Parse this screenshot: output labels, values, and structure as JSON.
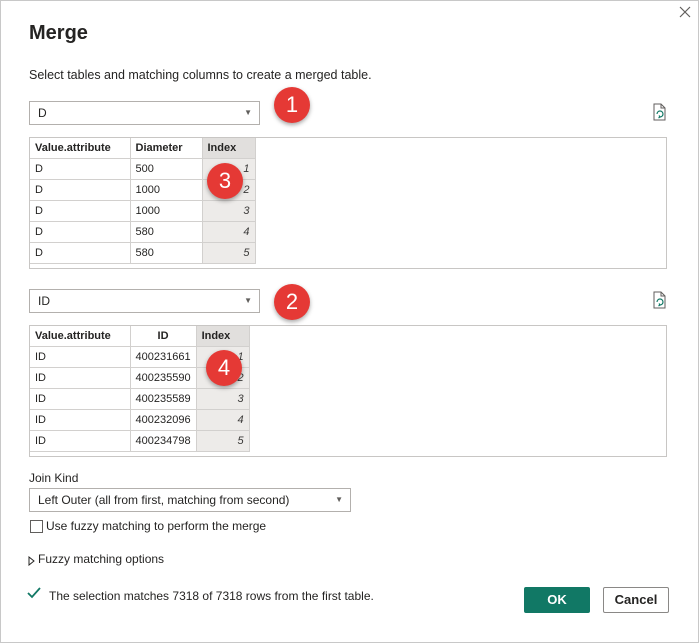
{
  "dialog": {
    "title": "Merge",
    "subtitle": "Select tables and matching columns to create a merged table.",
    "close_icon": "close-icon"
  },
  "first_table": {
    "selected": "D",
    "columns": [
      "Value.attribute",
      "Diameter",
      "Index"
    ],
    "rows": [
      [
        "D",
        "500",
        "1"
      ],
      [
        "D",
        "1000",
        "2"
      ],
      [
        "D",
        "1000",
        "3"
      ],
      [
        "D",
        "580",
        "4"
      ],
      [
        "D",
        "580",
        "5"
      ]
    ]
  },
  "second_table": {
    "selected": "ID",
    "columns": [
      "Value.attribute",
      "ID",
      "Index"
    ],
    "rows": [
      [
        "ID",
        "400231661",
        "1"
      ],
      [
        "ID",
        "400235590",
        "2"
      ],
      [
        "ID",
        "400235589",
        "3"
      ],
      [
        "ID",
        "400232096",
        "4"
      ],
      [
        "ID",
        "400234798",
        "5"
      ]
    ]
  },
  "annotations": {
    "b1": "1",
    "b2": "2",
    "b3": "3",
    "b4": "4"
  },
  "join": {
    "label": "Join Kind",
    "selected": "Left Outer (all from first, matching from second)"
  },
  "fuzzy": {
    "checkbox_label": "Use fuzzy matching to perform the merge",
    "options_label": "Fuzzy matching options",
    "checked": false
  },
  "status": {
    "text": "The selection matches 7318 of 7318 rows from the first table."
  },
  "buttons": {
    "ok": "OK",
    "cancel": "Cancel"
  },
  "colors": {
    "accent": "#117865",
    "badge": "#e53935",
    "selected_column": "#e1dfdd"
  }
}
